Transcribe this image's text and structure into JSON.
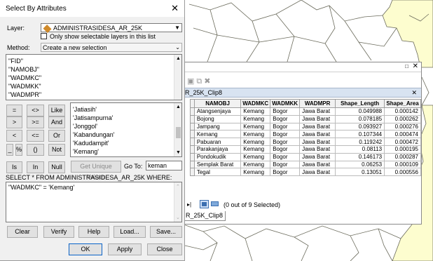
{
  "dialog": {
    "title": "Select By Attributes",
    "layer_label": "Layer:",
    "layer_value": "ADMINISTRASIDESA_AR_25K",
    "only_selectable_label": "Only show selectable layers in this list",
    "method_label": "Method:",
    "method_value": "Create a new selection",
    "fields": [
      "\"FID\"",
      "\"NAMOBJ\"",
      "\"WADMKC\"",
      "\"WADMKK\"",
      "\"WADMPR\""
    ],
    "selected_field": "\"WADMKC\"",
    "operators": [
      "=",
      "<>",
      "Like",
      ">",
      ">=",
      "And",
      "<",
      "<=",
      "Or",
      "_",
      "%",
      "()",
      "Not",
      "Is",
      "In",
      "Null"
    ],
    "values": [
      "'Jatiasih'",
      "'Jatisampurna'",
      "'Jonggol'",
      "'Kabandungan'",
      "'Kadudampit'",
      "'Kemang'"
    ],
    "selected_value": "'Kemang'",
    "get_unique_label": "Get Unique Values",
    "goto_label": "Go To:",
    "goto_value": "keman",
    "select_statement": "SELECT * FROM ADMINISTRASIDESA_AR_25K WHERE:",
    "where_clause": "\"WADMKC\" = 'Kemang'",
    "buttons": {
      "clear": "Clear",
      "verify": "Verify",
      "help": "Help",
      "load": "Load...",
      "save": "Save...",
      "ok": "OK",
      "apply": "Apply",
      "close": "Close"
    }
  },
  "attribute_table": {
    "tab_title": "R_25K_Clip8",
    "bottom_tab": "R_25K_Clip8",
    "columns": [
      "NAMOBJ",
      "WADMKC",
      "WADMKK",
      "WADMPR",
      "Shape_Length",
      "Shape_Area"
    ],
    "rows": [
      [
        "Atangsenjaya",
        "Kemang",
        "Bogor",
        "Jawa Barat",
        "0.049988",
        "0.000142"
      ],
      [
        "Bojong",
        "Kemang",
        "Bogor",
        "Jawa Barat",
        "0.078185",
        "0.000262"
      ],
      [
        "Jampang",
        "Kemang",
        "Bogor",
        "Jawa Barat",
        "0.093927",
        "0.000276"
      ],
      [
        "Kemang",
        "Kemang",
        "Bogor",
        "Jawa Barat",
        "0.107344",
        "0.000474"
      ],
      [
        "Pabuaran",
        "Kemang",
        "Bogor",
        "Jawa Barat",
        "0.119242",
        "0.000472"
      ],
      [
        "Parakanjaya",
        "Kemang",
        "Bogor",
        "Jawa Barat",
        "0.08113",
        "0.000195"
      ],
      [
        "Pondokudik",
        "Kemang",
        "Bogor",
        "Jawa Barat",
        "0.146173",
        "0.000287"
      ],
      [
        "Semplak Barat",
        "Kemang",
        "Bogor",
        "Jawa Barat",
        "0.06253",
        "0.000109"
      ],
      [
        "Tegal",
        "Kemang",
        "Bogor",
        "Jawa Barat",
        "0.13051",
        "0.000556"
      ]
    ],
    "status": "(0 out of 9 Selected)"
  },
  "colors": {
    "selection": "#0a64c8",
    "map_fill": "#fdfdcf",
    "map_line": "#6b6b5c",
    "tab_bg": "#d8e3f1"
  }
}
